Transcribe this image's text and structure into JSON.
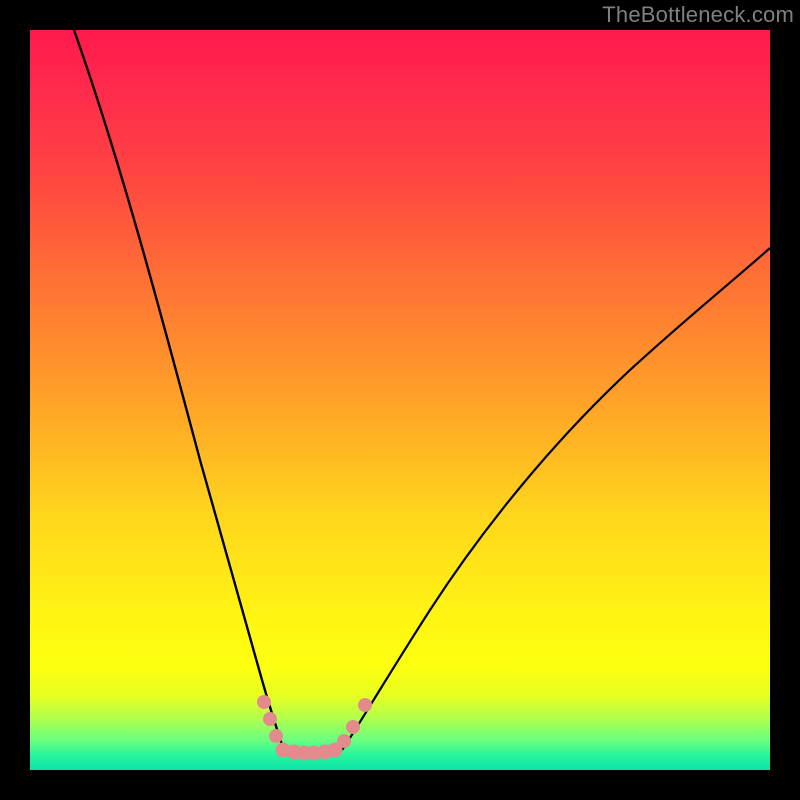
{
  "watermark": "TheBottleneck.com",
  "chart_data": {
    "type": "line",
    "title": "",
    "xlabel": "",
    "ylabel": "",
    "x_range": [
      0,
      100
    ],
    "y_range": [
      0,
      100
    ],
    "curve_left": {
      "description": "steep descending curve from top-left toward minimum",
      "x": [
        6,
        10,
        14,
        18,
        22,
        26,
        29,
        31,
        33,
        34
      ],
      "y": [
        100,
        86,
        71,
        55,
        40,
        26,
        15,
        9,
        5,
        2.5
      ]
    },
    "curve_right": {
      "description": "ascending curve from minimum toward upper-right",
      "x": [
        42,
        44,
        48,
        54,
        62,
        72,
        84,
        96,
        100
      ],
      "y": [
        2.5,
        5,
        11,
        21,
        34,
        47,
        59,
        68,
        71
      ]
    },
    "valley_floor": {
      "x": [
        34,
        42
      ],
      "y": [
        2.5,
        2.5
      ]
    },
    "markers_left": {
      "color": "#e28a8c",
      "points": [
        {
          "x": 31.5,
          "y": 9.2
        },
        {
          "x": 32.4,
          "y": 6.8
        },
        {
          "x": 33.3,
          "y": 4.4
        }
      ]
    },
    "markers_floor": {
      "color": "#e28a8c",
      "points": [
        {
          "x": 34.2,
          "y": 2.6
        },
        {
          "x": 35.6,
          "y": 2.4
        },
        {
          "x": 37.0,
          "y": 2.3
        },
        {
          "x": 38.4,
          "y": 2.3
        },
        {
          "x": 39.8,
          "y": 2.4
        },
        {
          "x": 41.2,
          "y": 2.6
        }
      ]
    },
    "markers_right": {
      "color": "#e28a8c",
      "points": [
        {
          "x": 42.5,
          "y": 3.9
        },
        {
          "x": 43.6,
          "y": 5.8
        },
        {
          "x": 45.2,
          "y": 8.8
        }
      ]
    },
    "colors": {
      "curve": "#000000",
      "marker": "#e28a8c",
      "gradient_top": "#ff1a4d",
      "gradient_bottom": "#0de3aa",
      "frame": "#000000"
    }
  }
}
